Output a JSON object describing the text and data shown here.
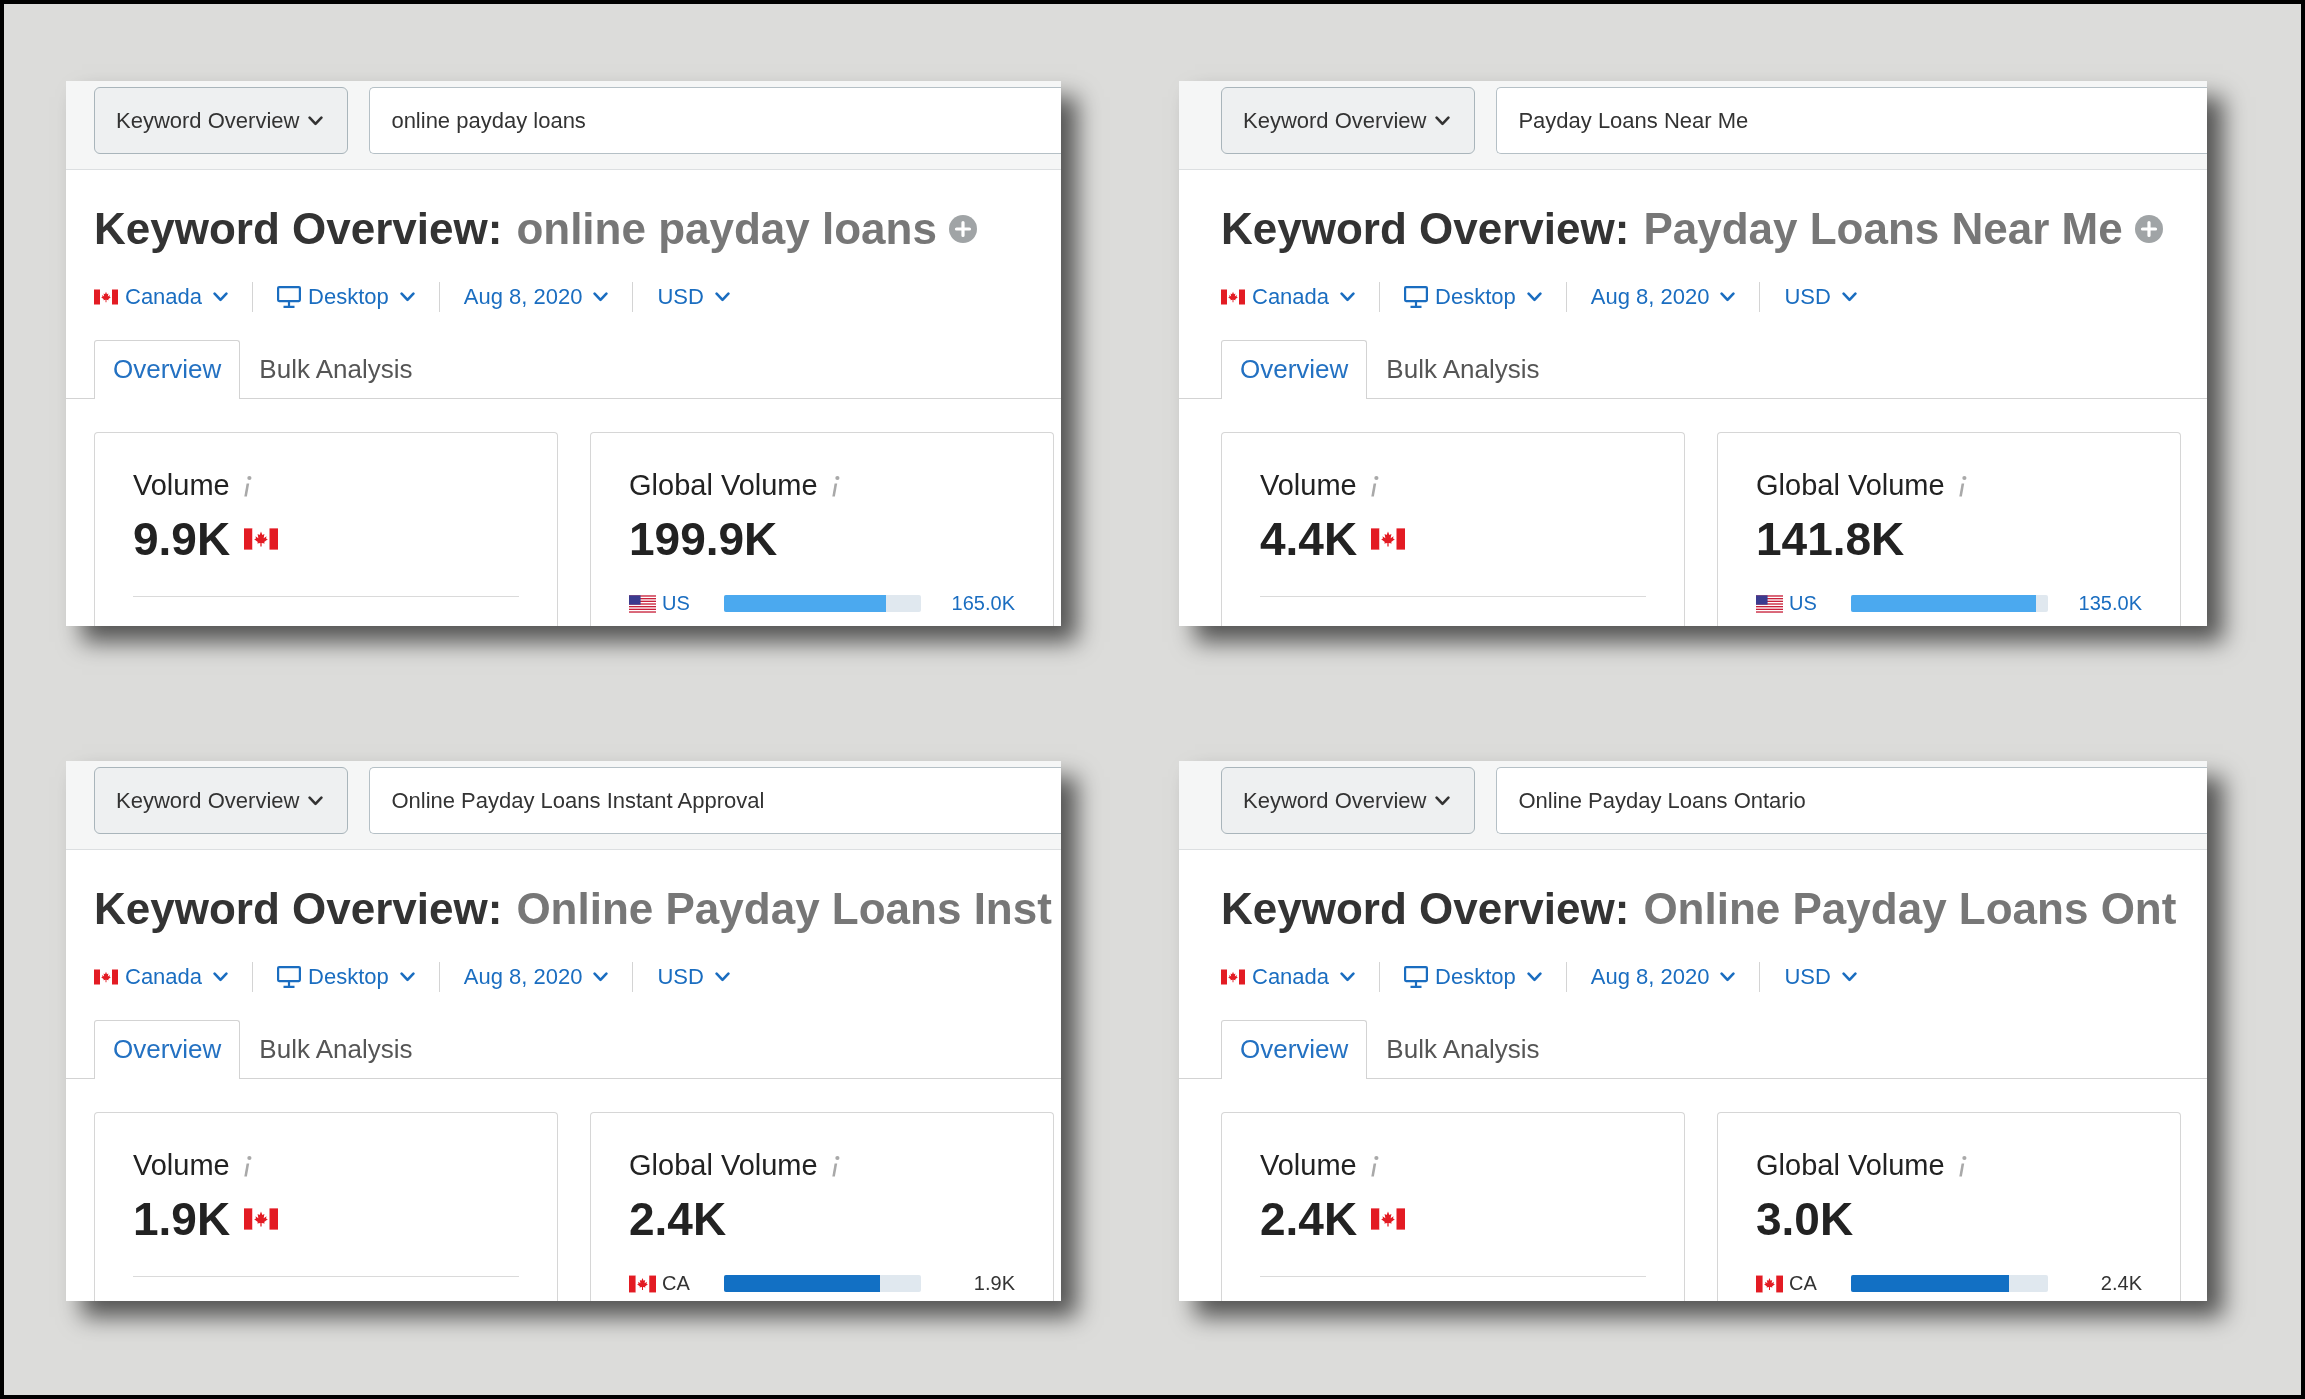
{
  "panels": [
    {
      "tool_menu": {
        "label": "Keyword Overview"
      },
      "search": {
        "value": "online payday loans"
      },
      "heading": {
        "label": "Keyword Overview:",
        "keyword": "online payday loans"
      },
      "filters": [
        {
          "kind": "database",
          "label": "Canada"
        },
        {
          "kind": "device",
          "label": "Desktop"
        },
        {
          "kind": "date",
          "label": "Aug 8, 2020"
        },
        {
          "kind": "currency",
          "label": "USD"
        }
      ],
      "tabs": [
        {
          "label": "Overview",
          "selected": true
        },
        {
          "label": "Bulk Analysis",
          "selected": false
        }
      ],
      "volume": {
        "label": "Volume",
        "value": "9.9K"
      },
      "global_volume": {
        "label": "Global Volume",
        "value": "199.9K",
        "countries": [
          {
            "kind": "us",
            "code": "US",
            "linked": true,
            "color": "#4ba9ef",
            "level": 0.82,
            "reading": "165.0K"
          }
        ]
      }
    },
    {
      "tool_menu": {
        "label": "Keyword Overview"
      },
      "search": {
        "value": "Payday Loans Near Me"
      },
      "heading": {
        "label": "Keyword Overview:",
        "keyword": "Payday Loans Near Me"
      },
      "filters": [
        {
          "kind": "database",
          "label": "Canada"
        },
        {
          "kind": "device",
          "label": "Desktop"
        },
        {
          "kind": "date",
          "label": "Aug 8, 2020"
        },
        {
          "kind": "currency",
          "label": "USD"
        }
      ],
      "tabs": [
        {
          "label": "Overview",
          "selected": true
        },
        {
          "label": "Bulk Analysis",
          "selected": false
        }
      ],
      "volume": {
        "label": "Volume",
        "value": "4.4K"
      },
      "global_volume": {
        "label": "Global Volume",
        "value": "141.8K",
        "countries": [
          {
            "kind": "us",
            "code": "US",
            "linked": true,
            "color": "#4ba9ef",
            "level": 0.94,
            "reading": "135.0K"
          }
        ]
      }
    },
    {
      "tool_menu": {
        "label": "Keyword Overview"
      },
      "search": {
        "value": "Online Payday Loans Instant Approval"
      },
      "heading": {
        "label": "Keyword Overview:",
        "keyword": "Online Payday Loans Inst"
      },
      "filters": [
        {
          "kind": "database",
          "label": "Canada"
        },
        {
          "kind": "device",
          "label": "Desktop"
        },
        {
          "kind": "date",
          "label": "Aug 8, 2020"
        },
        {
          "kind": "currency",
          "label": "USD"
        }
      ],
      "tabs": [
        {
          "label": "Overview",
          "selected": true
        },
        {
          "label": "Bulk Analysis",
          "selected": false
        }
      ],
      "volume": {
        "label": "Volume",
        "value": "1.9K"
      },
      "global_volume": {
        "label": "Global Volume",
        "value": "2.4K",
        "countries": [
          {
            "kind": "ca",
            "code": "CA",
            "linked": false,
            "color": "#1270c4",
            "level": 0.79,
            "reading": "1.9K"
          }
        ]
      }
    },
    {
      "tool_menu": {
        "label": "Keyword Overview"
      },
      "search": {
        "value": "Online Payday Loans Ontario"
      },
      "heading": {
        "label": "Keyword Overview:",
        "keyword": "Online Payday Loans Ont"
      },
      "filters": [
        {
          "kind": "database",
          "label": "Canada"
        },
        {
          "kind": "device",
          "label": "Desktop"
        },
        {
          "kind": "date",
          "label": "Aug 8, 2020"
        },
        {
          "kind": "currency",
          "label": "USD"
        }
      ],
      "tabs": [
        {
          "label": "Overview",
          "selected": true
        },
        {
          "label": "Bulk Analysis",
          "selected": false
        }
      ],
      "volume": {
        "label": "Volume",
        "value": "2.4K"
      },
      "global_volume": {
        "label": "Global Volume",
        "value": "3.0K",
        "countries": [
          {
            "kind": "ca",
            "code": "CA",
            "linked": false,
            "color": "#1270c4",
            "level": 0.8,
            "reading": "2.4K"
          }
        ]
      }
    }
  ]
}
